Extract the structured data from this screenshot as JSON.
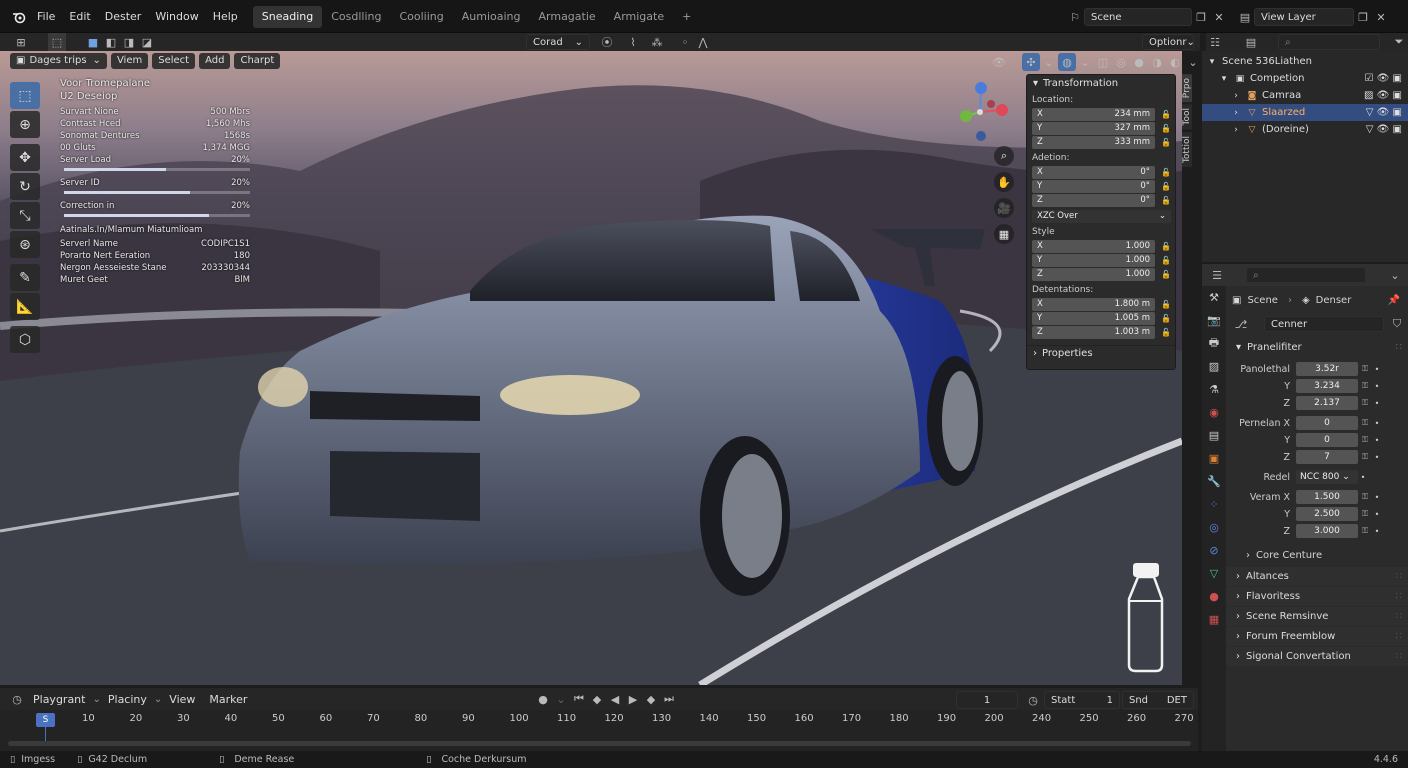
{
  "menu": {
    "file": "File",
    "edit": "Edit",
    "dester": "Dester",
    "window": "Window",
    "help": "Help"
  },
  "workspaces": [
    "Sneading",
    "Cosdlling",
    "Cooliing",
    "Aumioaing",
    "Armagatie",
    "Armigate"
  ],
  "active_workspace": 0,
  "top_right": {
    "scene_label": "Scene",
    "view_layer_label": "View Layer"
  },
  "header": {
    "coord_label": "Corad",
    "options_label": "Optionr"
  },
  "viewport_menu": {
    "mode": "Dages trips",
    "view": "Viem",
    "select": "Select",
    "add": "Add",
    "chart": "Charpt"
  },
  "stats": {
    "title1": "Voor Tromepalane",
    "title2": "U2 Deseiop",
    "rows": [
      {
        "label": "Survart Nione",
        "value": "500 Mbrs"
      },
      {
        "label": "Conttast Hced",
        "value": "1,560 Mhs"
      },
      {
        "label": "Sonomat Dentures",
        "value": "1568s"
      },
      {
        "label": "00 Gluts",
        "value": "1,374 MGG"
      },
      {
        "label": "Server Load",
        "value": "20%",
        "bar": 0.55
      },
      {
        "label": "Server ID",
        "value": "20%",
        "bar": 0.68
      },
      {
        "label": "Correction in",
        "value": "20%",
        "bar": 0.78
      }
    ],
    "section2": "Aatinals.In/Mlamum Miatumlioam",
    "rows2": [
      {
        "label": "Serverl Name",
        "value": "CODIPC1S1"
      },
      {
        "label": "Porarto Nert Eeration",
        "value": "180"
      },
      {
        "label": "Nergon Aesseieste Stane",
        "value": "203330344"
      },
      {
        "label": "Muret Geet",
        "value": "BlM"
      }
    ]
  },
  "npanel": {
    "title": "Transformation",
    "location_label": "Location:",
    "location": [
      {
        "axis": "X",
        "value": "234 mm"
      },
      {
        "axis": "Y",
        "value": "327 mm"
      },
      {
        "axis": "Z",
        "value": "333 mm"
      }
    ],
    "adetion_label": "Adetion:",
    "adetion": [
      {
        "axis": "X",
        "value": "0°"
      },
      {
        "axis": "Y",
        "value": "0°"
      },
      {
        "axis": "Z",
        "value": "0°"
      }
    ],
    "mode": "XZC Over",
    "style_label": "Style",
    "style": [
      {
        "axis": "X",
        "value": "1.000"
      },
      {
        "axis": "Y",
        "value": "1.000"
      },
      {
        "axis": "Z",
        "value": "1.000"
      }
    ],
    "dim_label": "Detentations:",
    "dims": [
      {
        "axis": "X",
        "value": "1.800 m"
      },
      {
        "axis": "Y",
        "value": "1.005 m"
      },
      {
        "axis": "Z",
        "value": "1.003 m"
      }
    ],
    "properties": "Properties",
    "tabs": [
      "Prpo",
      "Tool",
      "Tottiol"
    ]
  },
  "outliner": {
    "scene": "Scene 536Liathen",
    "items": [
      {
        "name": "Competion",
        "color": "#dddddd"
      },
      {
        "name": "Camraa",
        "color": "#e0a060"
      },
      {
        "name": "Slaarzed",
        "color": "#e0a060"
      },
      {
        "name": "(Doreine)",
        "color": "#dddddd"
      }
    ]
  },
  "props": {
    "scene": "Scene",
    "denser": "Denser",
    "field": "Cenner",
    "panel_title": "Pranelifiter",
    "rows_a": [
      {
        "label": "Panolethal",
        "value": "3.52r"
      },
      {
        "label": "Y",
        "value": "3.234"
      },
      {
        "label": "Z",
        "value": "2.137"
      }
    ],
    "rows_b": [
      {
        "label": "Pernelan X",
        "value": "0"
      },
      {
        "label": "Y",
        "value": "0"
      },
      {
        "label": "Z",
        "value": "7"
      }
    ],
    "redel_label": "Redel",
    "redel_value": "NCC 800",
    "rows_c": [
      {
        "label": "Veram X",
        "value": "1.500"
      },
      {
        "label": "Y",
        "value": "2.500"
      },
      {
        "label": "Z",
        "value": "3.000"
      }
    ],
    "sub": "Core Centure",
    "collapsed": [
      "Altances",
      "Flavoritess",
      "Scene Remsinve",
      "Forum Freemblow",
      "Sigonal Convertation"
    ]
  },
  "timeline": {
    "menu": [
      "Playgrant",
      "Placiny",
      "View",
      "Marker"
    ],
    "current": "1",
    "start_label": "Statt",
    "start": "1",
    "end_label": "Snd",
    "end": "DET",
    "marker": "S",
    "frames": [
      "10",
      "20",
      "30",
      "40",
      "50",
      "60",
      "70",
      "80",
      "90",
      "100",
      "110",
      "120",
      "130",
      "140",
      "150",
      "160",
      "170",
      "180",
      "190",
      "200",
      "240",
      "250",
      "260",
      "270"
    ]
  },
  "status": {
    "a": "Imgess",
    "b": "G42 Declum",
    "c": "Deme Rease",
    "d": "Coche Derkursum",
    "version": "4.4.6"
  }
}
